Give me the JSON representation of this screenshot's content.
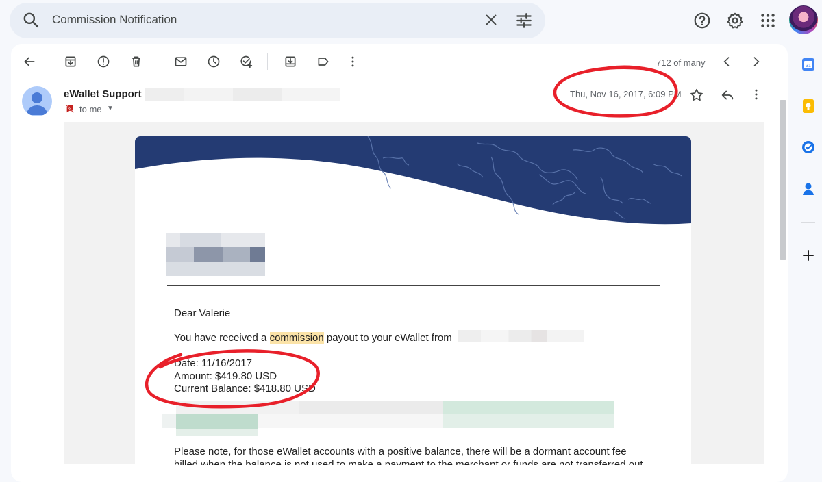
{
  "search": {
    "query": "Commission Notification"
  },
  "toolbar": {
    "pager_text": "712 of many"
  },
  "message": {
    "sender_name": "eWallet Support",
    "recipient": "to me",
    "date": "Thu, Nov 16, 2017, 6:09 PM"
  },
  "email": {
    "greeting": "Dear Valerie",
    "payout_prefix": "You have received a ",
    "payout_highlight": "commission",
    "payout_suffix": " payout to your eWallet from",
    "date_line": "Date: 11/16/2017",
    "amount_line": "Amount: $419.80 USD",
    "balance_line": "Current Balance: $418.80 USD",
    "note_line1": "Please note, for those eWallet accounts with a positive balance, there will be a dormant account fee",
    "note_line2": "billed when the balance is not used to make a payment to the merchant or funds are not transferred out"
  },
  "colors": {
    "banner": "#243b73",
    "annotation": "#e8202a",
    "highlight": "#fbe3a8"
  },
  "icons": {
    "toolbar": [
      "back-arrow-icon",
      "archive-icon",
      "report-spam-icon",
      "delete-icon",
      "mark-unread-icon",
      "snooze-icon",
      "add-task-icon",
      "move-to-icon",
      "label-icon",
      "more-vert-icon",
      "chevron-left-icon",
      "chevron-right-icon"
    ],
    "side_panel": [
      "calendar-icon",
      "keep-icon",
      "tasks-icon",
      "contacts-icon",
      "add-icon"
    ]
  }
}
